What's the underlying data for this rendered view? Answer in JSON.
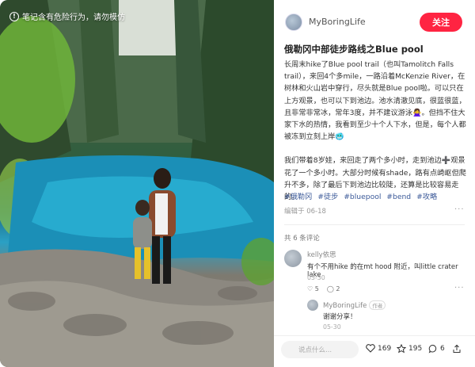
{
  "photo": {
    "warning": "笔记含有危险行为，请勿模仿"
  },
  "header": {
    "author": "MyBoringLife",
    "follow_label": "关注"
  },
  "post": {
    "title": "俄勒冈中部徒步路线之Blue pool",
    "paragraphs": [
      "长周末hike了Blue pool trail（也叫Tamolitch Falls trail），来回4个多mile，一路沿着McKenzie River，在树林和火山岩中穿行，尽头就是Blue pool啦。可以只在上方观景，也可以下到池边。池水清澈见底，很蓝很蓝，且非常非常冰，常年3度，并不建议游泳🙅‍♀️。但挡不住大家下水的热情，我看到至少十个人下水，但是，每个人都被冻到立刻上岸🥶",
      "我们带着8岁娃，来回走了两个多小时，走到池边➕观景花了一个多小时。大部分时候有shade，路有点崎岖但爬升不多，除了最后下到池边比较陡，还算是比较容易走的。"
    ],
    "tags": [
      "#俄勒冈",
      "#徒步",
      "#bluepool",
      "#bend",
      "#攻略"
    ],
    "edited": "编辑于 06-18"
  },
  "comments": {
    "count_label": "共 6 条评论",
    "items": [
      {
        "name": "kelly依思",
        "text": "有个不用hike 的在mt hood 附近，叫little crater lake",
        "date": "05-30",
        "likes": "5",
        "replies": "2"
      },
      {
        "name": "MyBoringLife",
        "badge": "作者",
        "text": "谢谢分享！",
        "date": "05-30"
      }
    ]
  },
  "bottom_bar": {
    "input_placeholder": "说点什么...",
    "likes": "169",
    "stars": "195",
    "comments": "6"
  },
  "colors": {
    "accent": "#ff2442",
    "tag": "#3b5998"
  }
}
